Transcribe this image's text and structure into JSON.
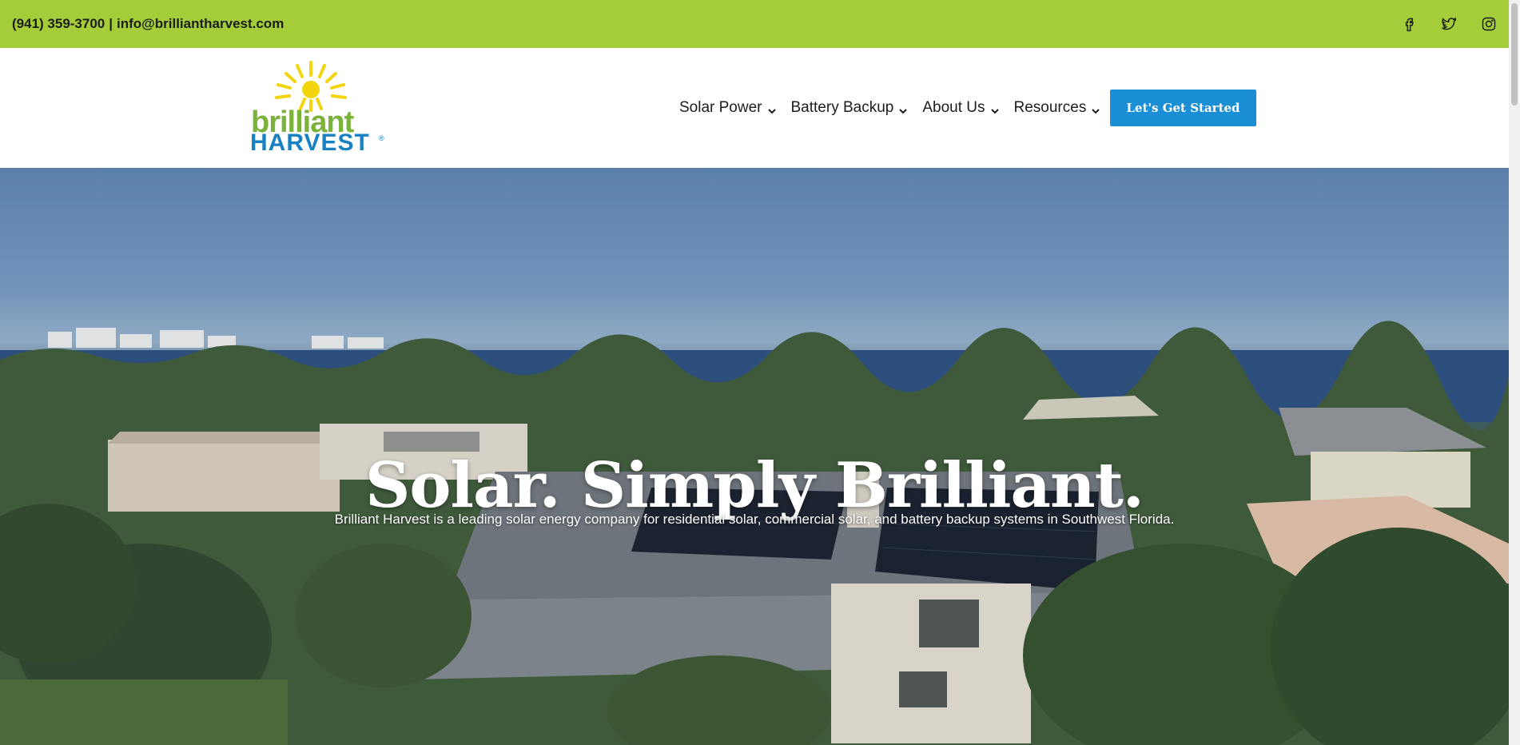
{
  "topbar": {
    "phone": "(941) 359-3700",
    "separator": "|",
    "email": "info@brilliantharvest.com",
    "social": [
      "facebook-icon",
      "twitter-icon",
      "instagram-icon"
    ],
    "background": "#a5cd3a"
  },
  "logo": {
    "line1": "brilliant",
    "line2": "HARVEST",
    "reg": "®"
  },
  "nav": {
    "items": [
      {
        "label": "Solar Power"
      },
      {
        "label": "Battery Backup"
      },
      {
        "label": "About Us"
      },
      {
        "label": "Resources"
      }
    ],
    "cta": "Let's Get Started",
    "cta_color": "#1a8fd6"
  },
  "hero": {
    "title": "Solar. Simply Brilliant.",
    "subtitle": "Brilliant Harvest is a leading solar energy company for residential solar, commercial solar, and battery backup systems in Southwest Florida."
  }
}
